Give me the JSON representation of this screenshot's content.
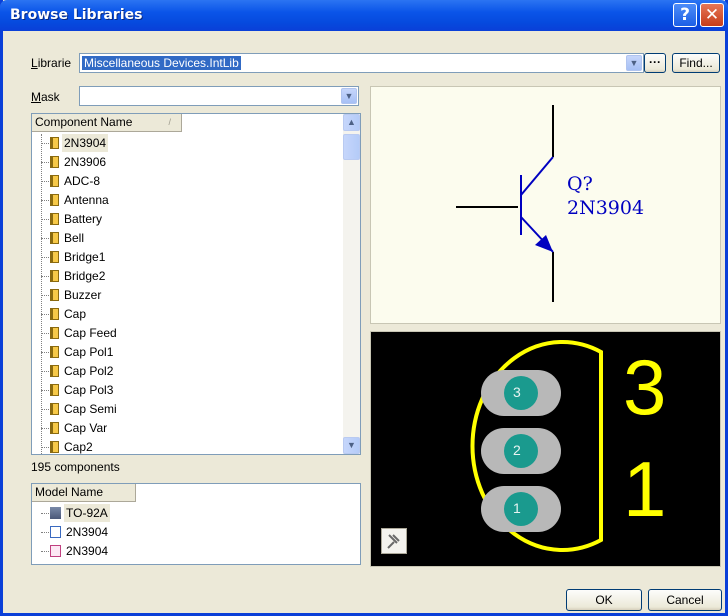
{
  "window": {
    "title": "Browse Libraries",
    "help_glyph": "?",
    "close_glyph": "✕"
  },
  "library": {
    "label_prefix": "L",
    "label_rest": "ibrarie",
    "selected": "Miscellaneous Devices.IntLib",
    "more_button": "···",
    "find_button": "Find..."
  },
  "mask": {
    "label_prefix": "M",
    "label_rest": "ask",
    "value": ""
  },
  "components": {
    "column_header": "Component Name",
    "sort_glyph": "/",
    "items": [
      "2N3904",
      "2N3906",
      "ADC-8",
      "Antenna",
      "Battery",
      "Bell",
      "Bridge1",
      "Bridge2",
      "Buzzer",
      "Cap",
      "Cap Feed",
      "Cap Pol1",
      "Cap Pol2",
      "Cap Pol3",
      "Cap Semi",
      "Cap Var",
      "Cap2"
    ],
    "selected_index": 0,
    "count_text": "195 components"
  },
  "models": {
    "column_header": "Model Name",
    "items": [
      {
        "name": "TO-92A",
        "icon": "footprint-icon"
      },
      {
        "name": "2N3904",
        "icon": "simulation-icon"
      },
      {
        "name": "2N3904",
        "icon": "signal-integrity-icon"
      }
    ]
  },
  "schematic_preview": {
    "designator": "Q?",
    "comment": "2N3904"
  },
  "pcb_preview": {
    "pad_numbers": [
      "3",
      "2",
      "1"
    ],
    "silk_labels": [
      "3",
      "1"
    ]
  },
  "buttons": {
    "ok": "OK",
    "cancel": "Cancel"
  },
  "colors": {
    "titlebar": "#0a54e8",
    "selection": "#316ac5",
    "schematic_stroke": "#0000c0",
    "silkscreen": "#ffff00",
    "pad": "#b8b8b8",
    "pad_hole": "#1a9a8e"
  }
}
